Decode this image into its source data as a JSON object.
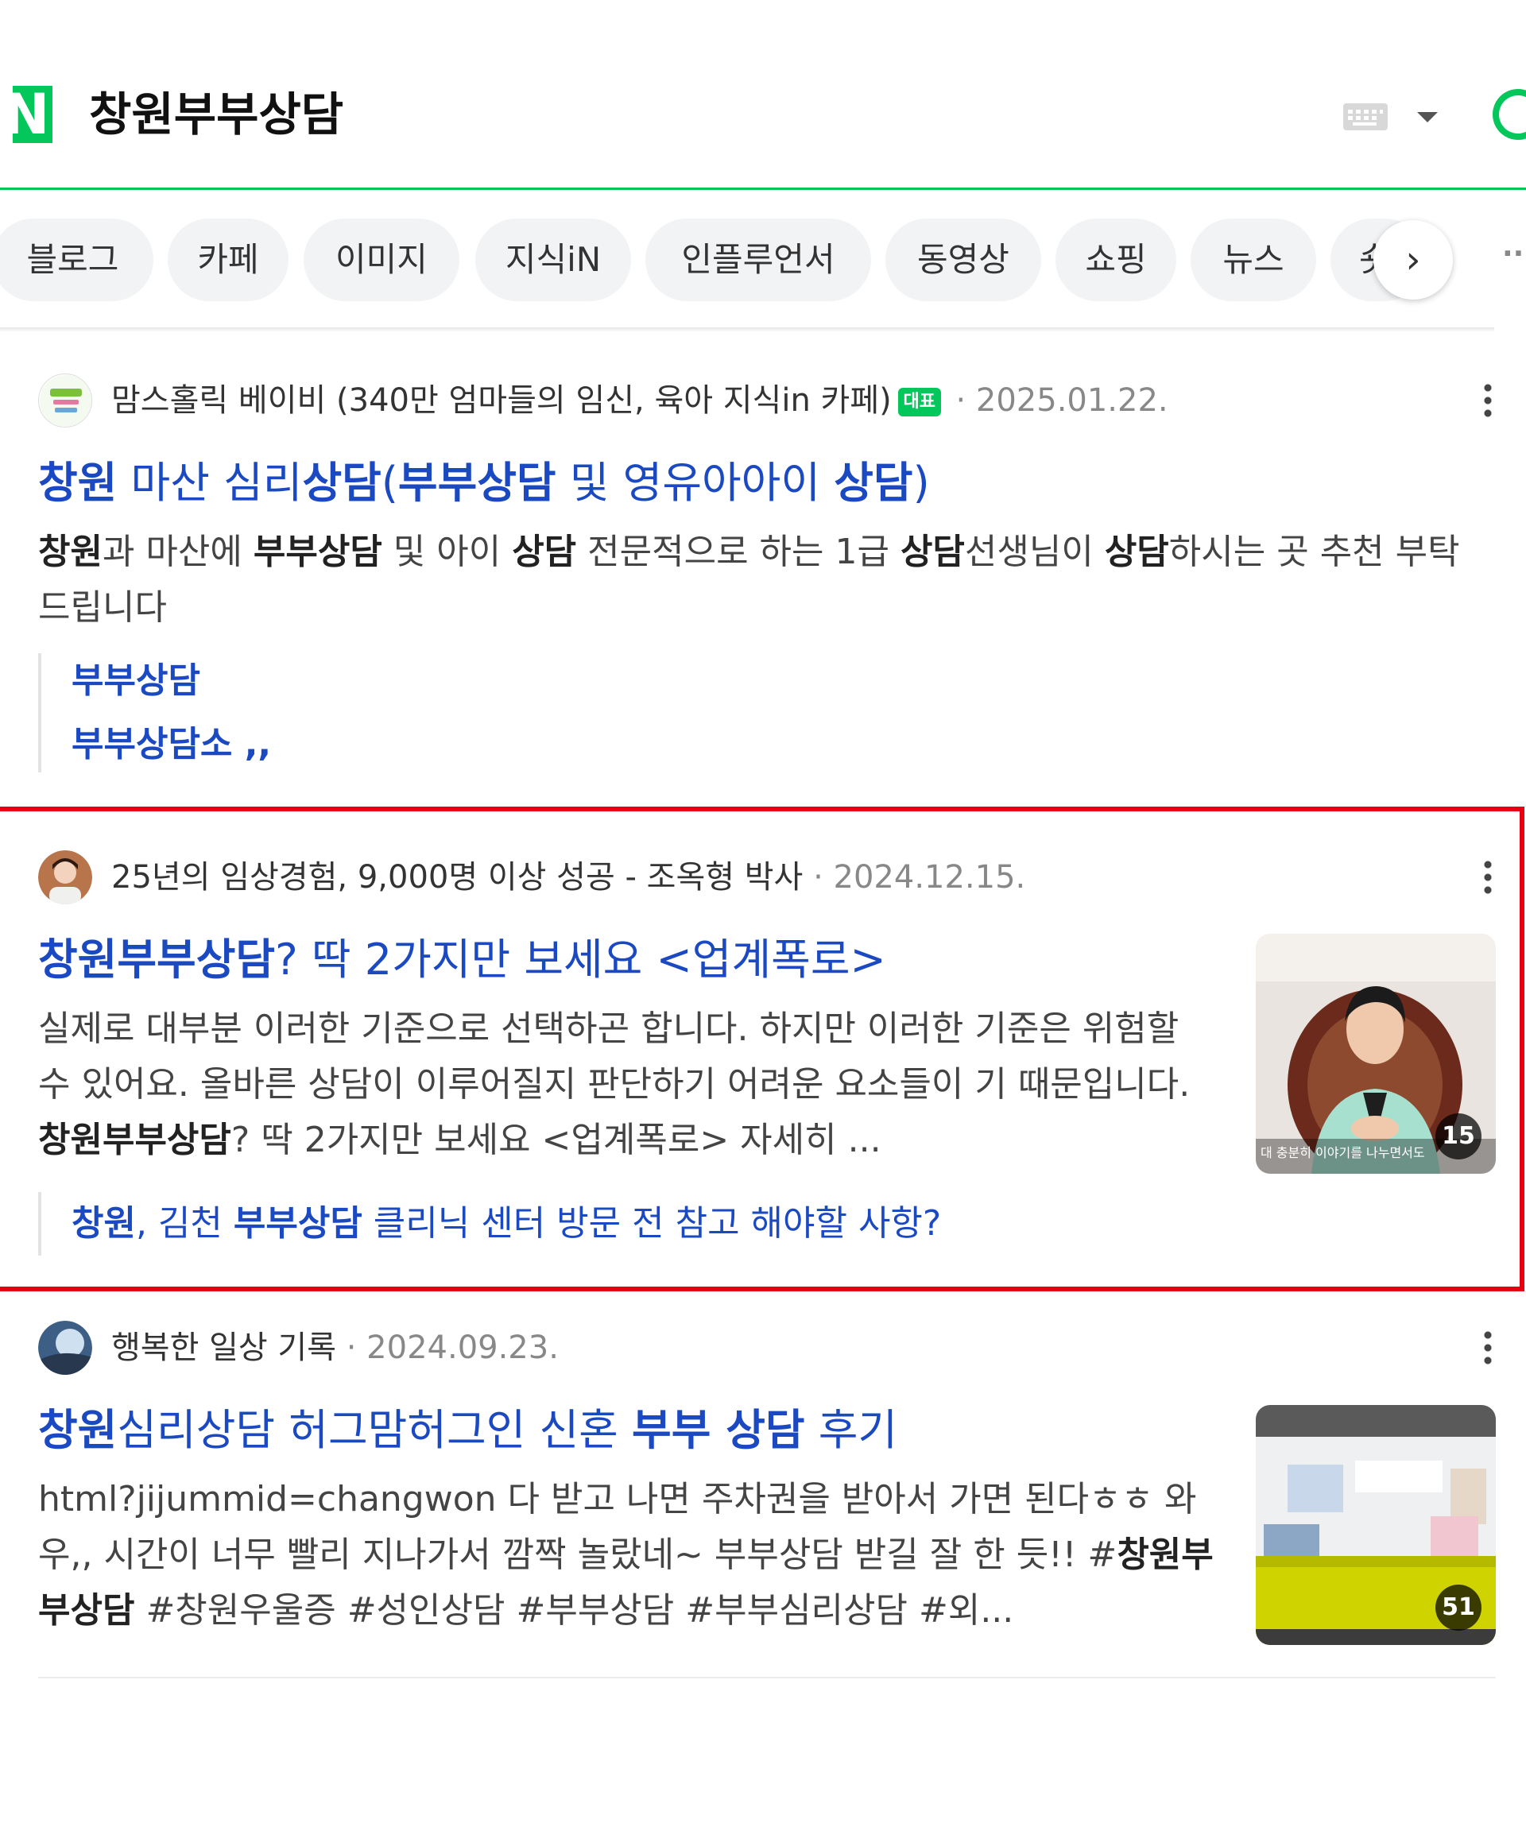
{
  "header": {
    "logo_letter": "N",
    "query": "창원부부상담",
    "brand_color": "#03c75a"
  },
  "tabs": [
    {
      "label": "블로그"
    },
    {
      "label": "카페"
    },
    {
      "label": "이미지"
    },
    {
      "label": "지식iN"
    },
    {
      "label": "인플루언서"
    },
    {
      "label": "동영상"
    },
    {
      "label": "쇼핑"
    },
    {
      "label": "뉴스"
    },
    {
      "label": "숏"
    }
  ],
  "tab_next_glyph": "›",
  "tab_more_glyph": "··",
  "results": [
    {
      "source_name": "맘스홀릭 베이비 (340만 엄마들의 임신, 육아 지식in 카페)",
      "badge": "대표",
      "date": " · 2025.01.22.",
      "title_parts": [
        "창원",
        " 마산 심리",
        "상담",
        "(",
        "부부상담",
        " 및 영유아아이 ",
        "상담",
        ")"
      ],
      "desc_parts": [
        "창원",
        "과 마산에 ",
        "부부상담",
        " 및 아이 ",
        "상담",
        " 전문적으로 하는 1급 ",
        "상담",
        "선생님이 ",
        "상담",
        "하시는 곳 추천 부탁드립니다"
      ],
      "sub_links": [
        "부부상담",
        "부부상담소 ,,"
      ]
    },
    {
      "source_name": "25년의 임상경험, 9,000명 이상 성공 - 조옥형 박사",
      "date": " · 2024.12.15.",
      "title_parts": [
        "창원부부상담",
        "? 딱 2가지만 보세요 <업계폭로>"
      ],
      "desc_parts": [
        "실제로 대부분 이러한 기준으로 선택하곤 합니다. 하지만 이러한 기준은 위험할 수 있어요. 올바른 상담이 이루어질지 판단하기 어려운 요소들이 기 때문입니다. ",
        "창원부부상담",
        "? 딱 2가지만 보세요 <업계폭로> 자세히 ..."
      ],
      "sub_link_parts": [
        "창원",
        ", 김천 ",
        "부부상담",
        " 클리닉 센터 방문 전 참고 해야할 사항?"
      ],
      "thumb_caption": "대 충분히 이야기를 나누면서도",
      "thumb_count": "15"
    },
    {
      "source_name": "행복한 일상 기록",
      "date": " · 2024.09.23.",
      "title_parts": [
        "창원",
        "심리상담 허그맘허그인 신혼 ",
        "부부 상담",
        " 후기"
      ],
      "desc_parts": [
        "html?jijummid=changwon 다 받고 나면 주차권을 받아서 가면 된다ㅎㅎ 와우,, 시간이 너무 빨리 지나가서 깜짝 놀랐네~ 부부상담 받길 잘 한 듯!! #",
        "창원부부상담",
        " #창원우울증 #성인상담 #부부상담 #부부심리상담 #외..."
      ],
      "thumb_count": "51"
    }
  ],
  "colors": {
    "link": "#1a49c2",
    "highlight_border": "#e60012",
    "date": "#888888"
  }
}
